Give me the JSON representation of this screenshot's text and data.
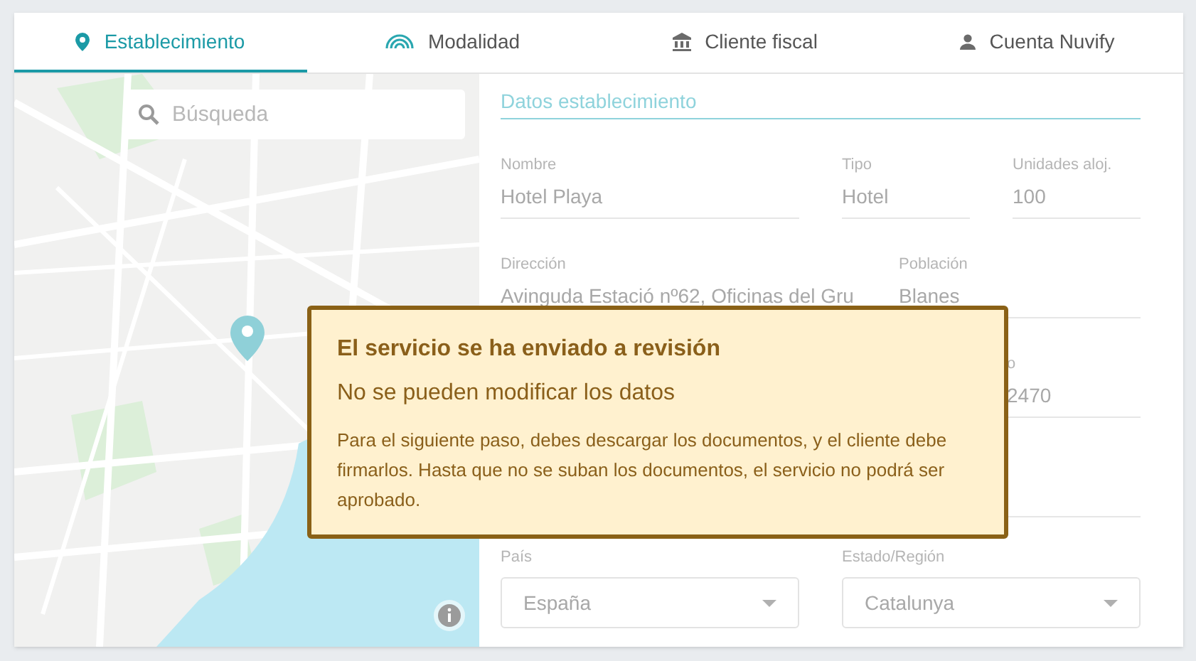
{
  "tabs": [
    {
      "label": "Establecimiento",
      "selected": true
    },
    {
      "label": "Modalidad",
      "selected": false
    },
    {
      "label": "Cliente fiscal",
      "selected": false
    },
    {
      "label": "Cuenta Nuvify",
      "selected": false
    }
  ],
  "map": {
    "search": {
      "placeholder": "Búsqueda"
    }
  },
  "section_title": "Datos establecimiento",
  "rows": [
    [
      {
        "label": "Nombre",
        "value": "Hotel Playa"
      },
      {
        "label": "Tipo",
        "value": "Hotel"
      },
      {
        "label": "Unidades aloj.",
        "value": "100"
      }
    ],
    [
      {
        "label": "Dirección",
        "value": "Avinguda Estació nº62, Oficinas del Gru"
      },
      {
        "label": "Población",
        "value": "Blanes"
      }
    ]
  ],
  "partial_field": {
    "label": "o",
    "value": "2470"
  },
  "selects": [
    {
      "label": "País",
      "value": "España"
    },
    {
      "label": "Estado/Región",
      "value": "Catalunya"
    }
  ],
  "notice": {
    "title": "El servicio se ha enviado a revisión",
    "subtitle": "No se pueden modificar los datos",
    "body": "Para el siguiente paso, debes descargar los documentos, y el cliente debe firmarlos. Hasta que no se suban los documentos, el servicio no podrá ser aprobado."
  }
}
